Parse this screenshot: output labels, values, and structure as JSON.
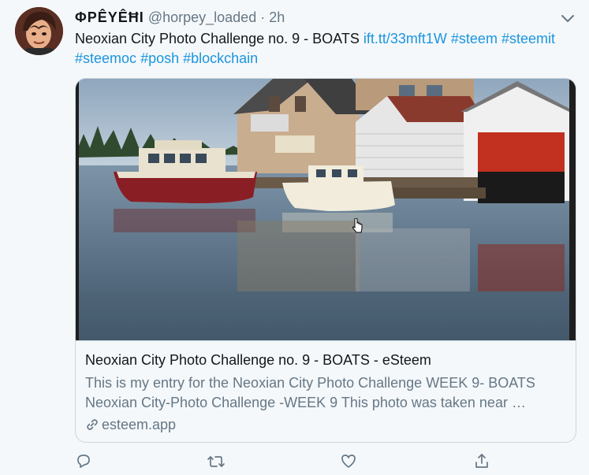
{
  "tweet": {
    "author_name": "🅟🅔🅨🅔🅗🅘 — stylized",
    "author_display": "ΦPÊΥÊĦI",
    "handle": "@horpey_loaded",
    "separator": "·",
    "time": "2h",
    "text_plain": "Neoxian City Photo Challenge no. 9 - BOATS ",
    "link_url": "ift.tt/33mft1W",
    "hashtags": [
      "#steem",
      "#steemit",
      "#steemoc",
      "#posh",
      "#blockchain"
    ]
  },
  "card": {
    "title": "Neoxian City Photo Challenge no. 9 - BOATS - eSteem",
    "description": "This is my entry for the Neoxian City Photo Challenge WEEK 9- BOATS Neoxian City-Photo Challenge -WEEK 9 This photo was taken near …",
    "domain": "esteem.app"
  },
  "actions": {
    "reply": "reply-icon",
    "retweet": "retweet-icon",
    "like": "heart-icon",
    "share": "share-icon"
  },
  "colors": {
    "link": "#1b95e0",
    "secondary": "#657786",
    "border": "#ccd6dd",
    "background": "#f5f8fa"
  }
}
